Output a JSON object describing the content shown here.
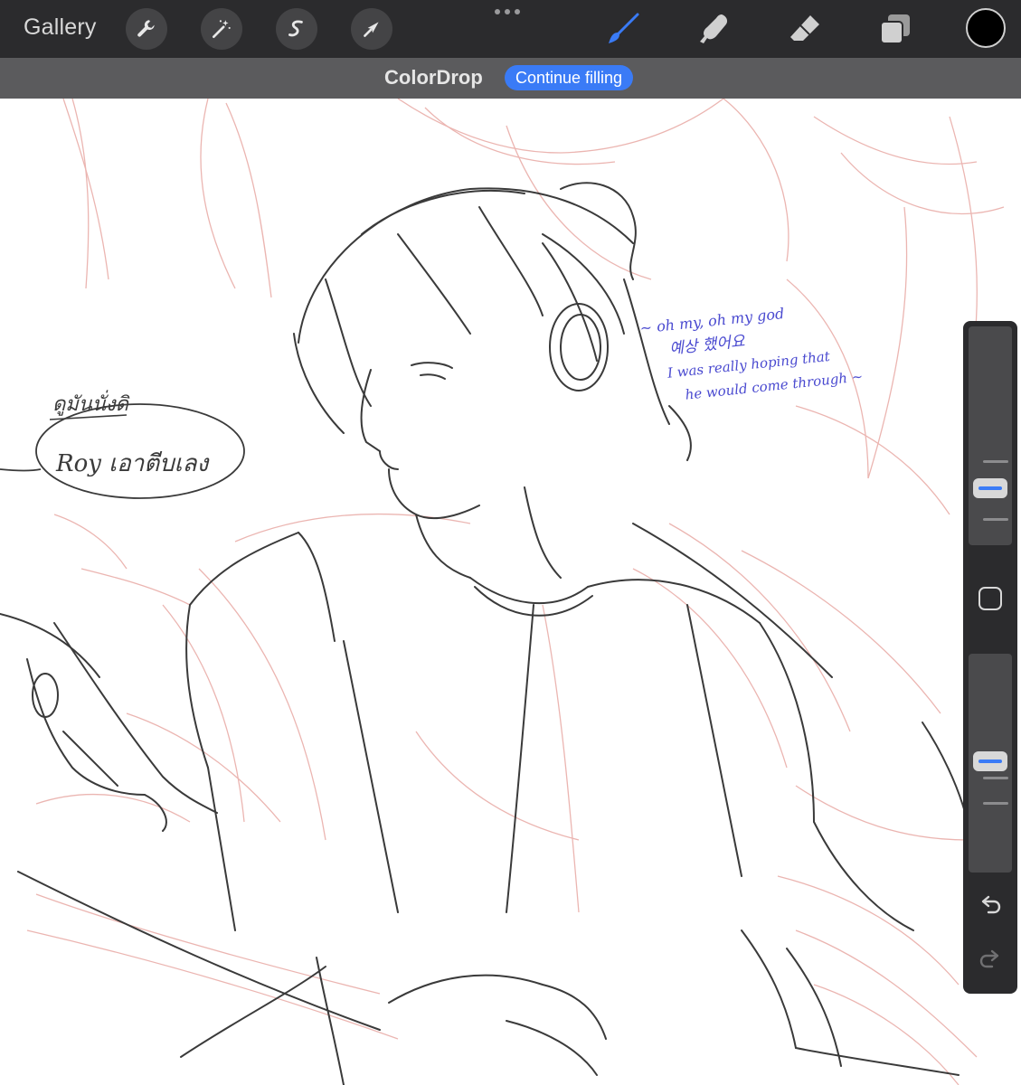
{
  "toolbar": {
    "gallery_label": "Gallery",
    "left_tools": [
      "wrench-icon",
      "magic-wand-icon",
      "selection-icon",
      "transform-arrow-icon"
    ],
    "right_tools": [
      "brush-icon",
      "smudge-icon",
      "eraser-icon",
      "layers-icon"
    ],
    "active_tool": "brush-icon",
    "accent_color": "#3a7bf6",
    "current_color": "#000000"
  },
  "subbar": {
    "title": "ColorDrop",
    "continue_label": "Continue filling"
  },
  "canvas": {
    "note_thai_top": "ดูมันนั่งดิ",
    "note_bubble": "Roy เอาตีบเลง",
    "note_right": [
      "~ oh my, oh my god",
      "예상 했어요",
      "I was really hoping that",
      "he would come through ~"
    ],
    "sketch_color": "#e8a9a4",
    "line_color": "#3a3a3a",
    "note_blue": "#4a4ad0"
  },
  "sidebar": {
    "size_level": 0.2,
    "opacity_level": 0.5
  }
}
